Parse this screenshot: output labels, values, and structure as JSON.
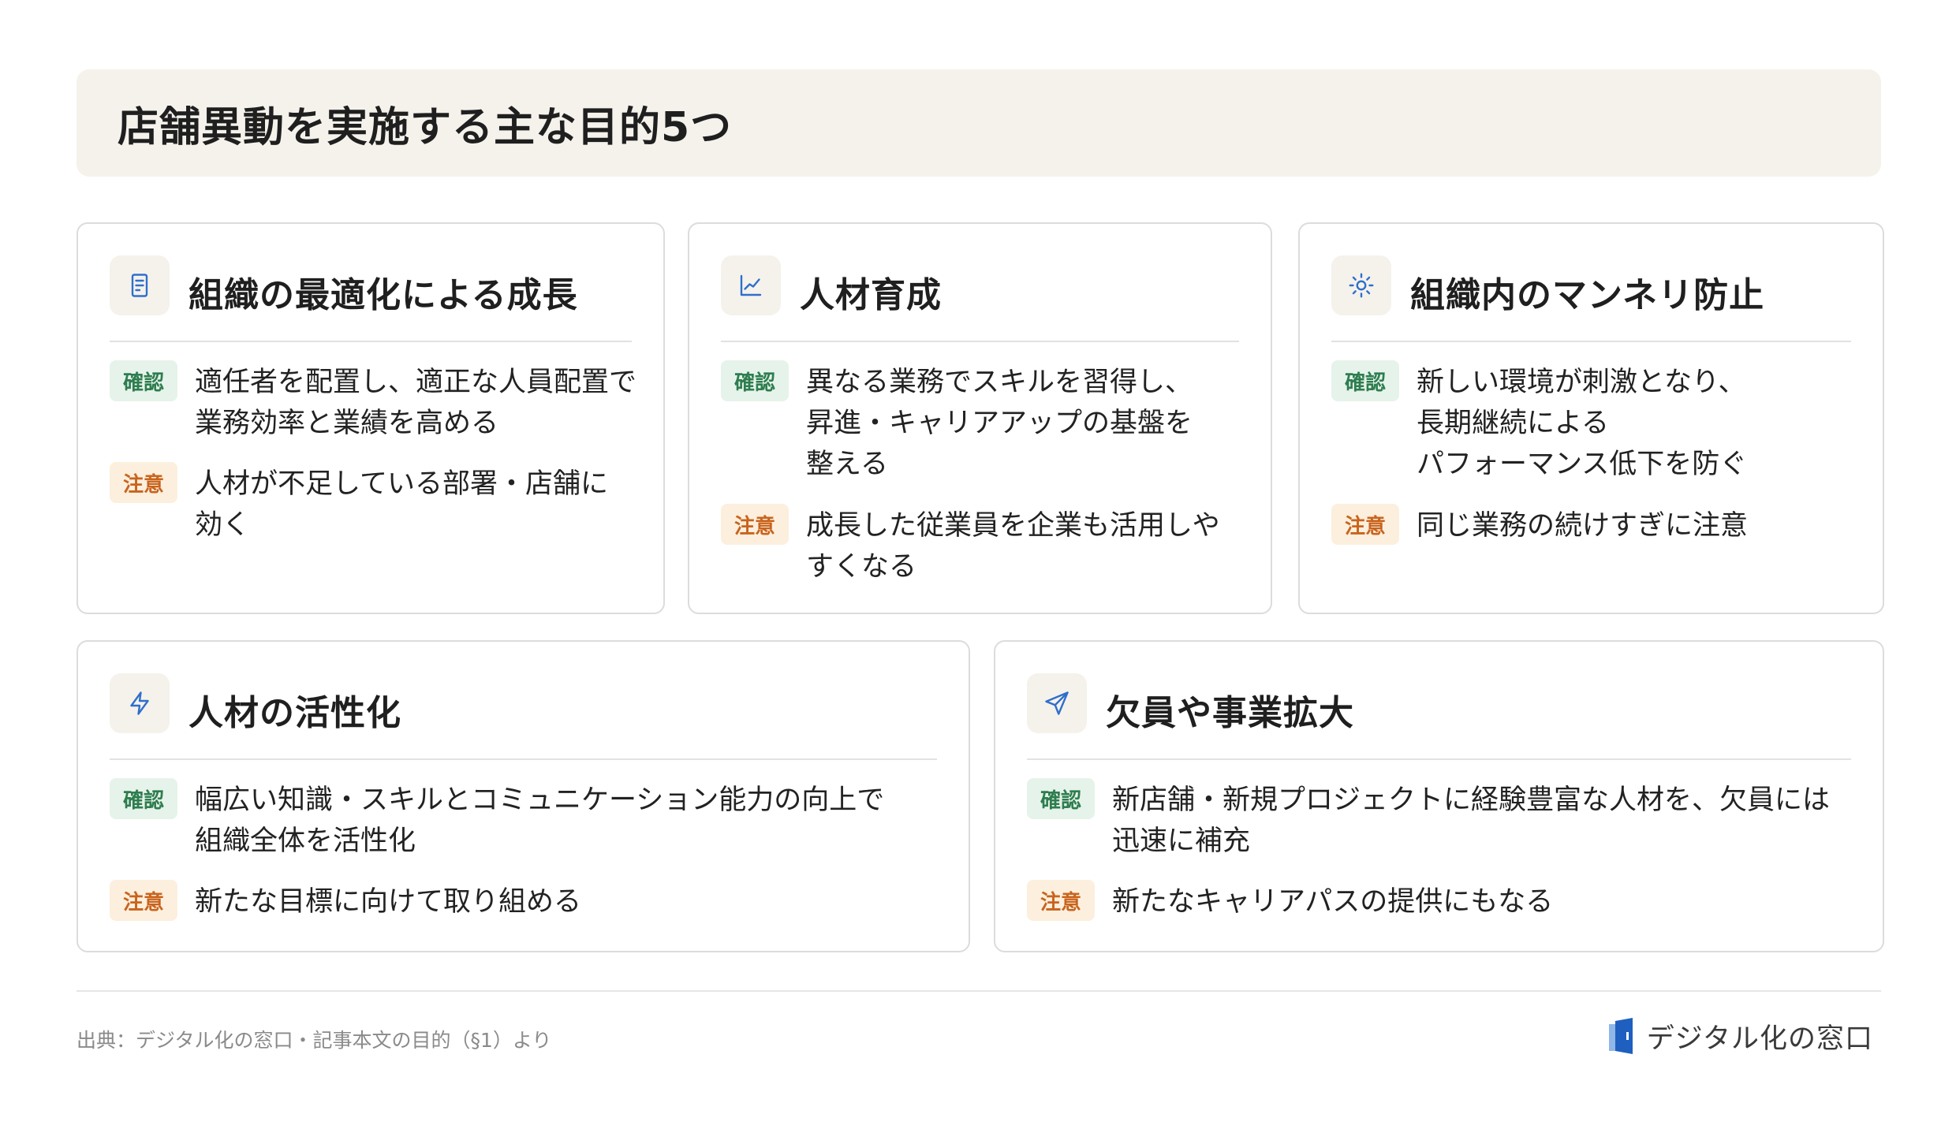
{
  "title": "店舗異動を実施する主な目的5つ",
  "badges": {
    "confirm": "確認",
    "caution": "注意"
  },
  "cards": [
    {
      "icon": "document-icon",
      "title": "組織の最適化による成長",
      "confirm": "適任者を配置し、適正な人員配置で\n業務効率と業績を高める",
      "caution": "人材が不足している部署・店舗に\n効く"
    },
    {
      "icon": "line-chart-icon",
      "title": "人材育成",
      "confirm": "異なる業務でスキルを習得し、\n昇進・キャリアアップの基盤を\n整える",
      "caution": "成長した従業員を企業も活用しや\nすくなる"
    },
    {
      "icon": "sun-icon",
      "title": "組織内のマンネリ防止",
      "confirm": "新しい環境が刺激となり、\n長期継続による\nパフォーマンス低下を防ぐ",
      "caution": "同じ業務の続けすぎに注意"
    },
    {
      "icon": "lightning-icon",
      "title": "人材の活性化",
      "confirm": "幅広い知識・スキルとコミュニケーション能力の向上で\n組織全体を活性化",
      "caution": "新たな目標に向けて取り組める"
    },
    {
      "icon": "send-icon",
      "title": "欠員や事業拡大",
      "confirm": "新店舗・新規プロジェクトに経験豊富な人材を、欠員には\n迅速に補充",
      "caution": "新たなキャリアパスの提供にもなる"
    }
  ],
  "footer": {
    "source": "出典：デジタル化の窓口・記事本文の目的（§1）より",
    "brand": "デジタル化の窓口"
  },
  "colors": {
    "accent_blue": "#2f6fcb",
    "confirm_bg": "#e6f3ea",
    "confirm_text": "#2e7d4f",
    "caution_bg": "#fcefdd",
    "caution_text": "#c8641e",
    "title_bg": "#f5f2ec"
  }
}
